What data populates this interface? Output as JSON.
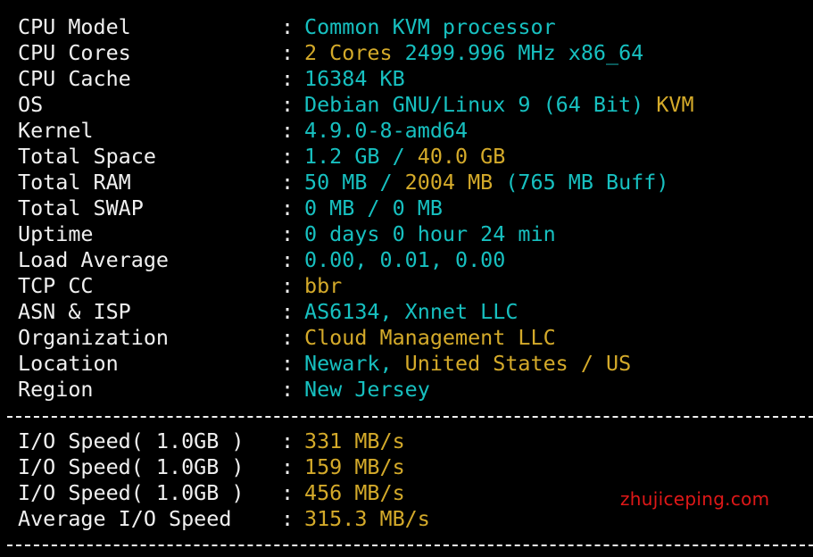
{
  "rows": [
    {
      "label": "CPU Model",
      "parts": [
        {
          "text": "Common KVM processor",
          "color": "cyan"
        }
      ]
    },
    {
      "label": "CPU Cores",
      "parts": [
        {
          "text": "2 Cores ",
          "color": "yellow"
        },
        {
          "text": "2499.996 MHz x86_64",
          "color": "cyan"
        }
      ]
    },
    {
      "label": "CPU Cache",
      "parts": [
        {
          "text": "16384 KB",
          "color": "cyan"
        }
      ]
    },
    {
      "label": "OS",
      "parts": [
        {
          "text": "Debian GNU/Linux 9 (64 Bit) ",
          "color": "cyan"
        },
        {
          "text": "KVM",
          "color": "yellow"
        }
      ]
    },
    {
      "label": "Kernel",
      "parts": [
        {
          "text": "4.9.0-8-amd64",
          "color": "cyan"
        }
      ]
    },
    {
      "label": "Total Space",
      "parts": [
        {
          "text": "1.2 GB / ",
          "color": "cyan"
        },
        {
          "text": "40.0 GB",
          "color": "yellow"
        }
      ]
    },
    {
      "label": "Total RAM",
      "parts": [
        {
          "text": "50 MB / ",
          "color": "cyan"
        },
        {
          "text": "2004 MB ",
          "color": "yellow"
        },
        {
          "text": "(765 MB Buff)",
          "color": "cyan"
        }
      ]
    },
    {
      "label": "Total SWAP",
      "parts": [
        {
          "text": "0 MB / 0 MB",
          "color": "cyan"
        }
      ]
    },
    {
      "label": "Uptime",
      "parts": [
        {
          "text": "0 days 0 hour 24 min",
          "color": "cyan"
        }
      ]
    },
    {
      "label": "Load Average",
      "parts": [
        {
          "text": "0.00, 0.01, 0.00",
          "color": "cyan"
        }
      ]
    },
    {
      "label": "TCP CC",
      "parts": [
        {
          "text": "bbr",
          "color": "yellow"
        }
      ]
    },
    {
      "label": "ASN & ISP",
      "parts": [
        {
          "text": "AS6134, Xnnet LLC",
          "color": "cyan"
        }
      ]
    },
    {
      "label": "Organization",
      "parts": [
        {
          "text": "Cloud Management LLC",
          "color": "yellow"
        }
      ]
    },
    {
      "label": "Location",
      "parts": [
        {
          "text": "Newark, ",
          "color": "cyan"
        },
        {
          "text": "United States / US",
          "color": "yellow"
        }
      ]
    },
    {
      "label": "Region",
      "parts": [
        {
          "text": "New Jersey",
          "color": "cyan"
        }
      ]
    }
  ],
  "io_rows": [
    {
      "label": "I/O Speed( 1.0GB )",
      "parts": [
        {
          "text": "331 MB/s",
          "color": "yellow"
        }
      ]
    },
    {
      "label": "I/O Speed( 1.0GB )",
      "parts": [
        {
          "text": "159 MB/s",
          "color": "yellow"
        }
      ]
    },
    {
      "label": "I/O Speed( 1.0GB )",
      "parts": [
        {
          "text": "456 MB/s",
          "color": "yellow"
        }
      ]
    },
    {
      "label": "Average I/O Speed",
      "parts": [
        {
          "text": "315.3 MB/s",
          "color": "yellow"
        }
      ]
    }
  ],
  "separator_char": ":",
  "watermark": "zhujiceping.com",
  "colors": {
    "background": "#000000",
    "label": "#f0f0f0",
    "cyan": "#17c0c0",
    "yellow": "#d4aa2a",
    "watermark": "#e01818"
  }
}
